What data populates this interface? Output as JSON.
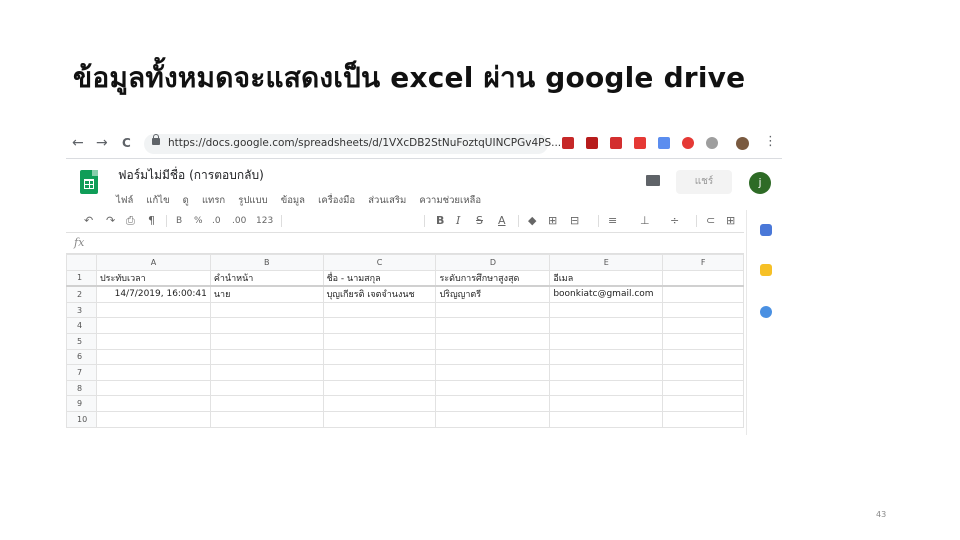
{
  "slide": {
    "title": "ข้อมูลทั้งหมดจะแสดงเป็น excel ผ่าน google drive",
    "page_number": "43"
  },
  "browser": {
    "back": "←",
    "forward": "→",
    "reload": "C",
    "url": "https://docs.google.com/spreadsheets/d/1VXcDB2StNuFoztqUINCPGv4PS...",
    "star": "☆",
    "menu": "⋮"
  },
  "sheets": {
    "doc_title": "ฟอร์มไม่มีชื่อ (การตอบกลับ)",
    "menus": [
      "ไฟล์",
      "แก้ไข",
      "ดู",
      "แทรก",
      "รูปแบบ",
      "ข้อมูล",
      "เครื่องมือ",
      "ส่วนเสริม",
      "ความช่วยเหลือ"
    ],
    "share_label": "แชร์",
    "avatar_letter": "j",
    "fx_label": "fx",
    "toolbar": {
      "undo": "↶",
      "redo": "↷",
      "print": "⎙",
      "paint": "¶",
      "currency": "B",
      "percent": "%",
      "dec_minus": ".0",
      "dec_plus": ".00",
      "format_num": "123",
      "bold": "B",
      "italic": "I",
      "strike": "S",
      "text_color": "A",
      "fill": "◆",
      "borders": "⊞",
      "merge": "⊟",
      "halign": "≡",
      "valign": "⊥",
      "rotate": "÷",
      "link": "⊂",
      "comment": "⊞"
    },
    "columns": [
      "A",
      "B",
      "C",
      "D",
      "E",
      "F"
    ],
    "rows": [
      {
        "num": "1",
        "cells": [
          "ประทับเวลา",
          "คำนำหน้า",
          "ชื่อ - นามสกุล",
          "ระดับการศึกษาสูงสุด",
          "อีเมล",
          ""
        ]
      },
      {
        "num": "2",
        "cells": [
          "14/7/2019, 16:00:41",
          "นาย",
          "บุญเกียรติ เจตจำนงนช",
          "ปริญญาตรี",
          "boonkiatc@gmail.com",
          ""
        ]
      },
      {
        "num": "3",
        "cells": [
          "",
          "",
          "",
          "",
          "",
          ""
        ]
      },
      {
        "num": "4",
        "cells": [
          "",
          "",
          "",
          "",
          "",
          ""
        ]
      },
      {
        "num": "5",
        "cells": [
          "",
          "",
          "",
          "",
          "",
          ""
        ]
      },
      {
        "num": "6",
        "cells": [
          "",
          "",
          "",
          "",
          "",
          ""
        ]
      },
      {
        "num": "7",
        "cells": [
          "",
          "",
          "",
          "",
          "",
          ""
        ]
      },
      {
        "num": "8",
        "cells": [
          "",
          "",
          "",
          "",
          "",
          ""
        ]
      },
      {
        "num": "9",
        "cells": [
          "",
          "",
          "",
          "",
          "",
          ""
        ]
      },
      {
        "num": "10",
        "cells": [
          "",
          "",
          "",
          "",
          "",
          ""
        ]
      }
    ]
  },
  "colors": {
    "sheets_green": "#0f9d58",
    "avatar_green": "#2e6b26"
  }
}
